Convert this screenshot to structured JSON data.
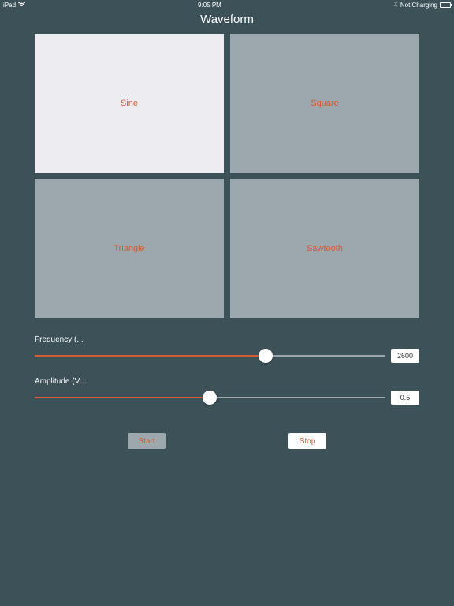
{
  "statusBar": {
    "device": "iPad",
    "time": "9:05 PM",
    "chargeStatus": "Not Charging"
  },
  "header": {
    "title": "Waveform"
  },
  "waveforms": [
    {
      "label": "Sine",
      "selected": true
    },
    {
      "label": "Square",
      "selected": false
    },
    {
      "label": "Triangle",
      "selected": false
    },
    {
      "label": "Sawtooth",
      "selected": false
    }
  ],
  "sliders": {
    "frequency": {
      "label": "Frequency (...",
      "value": "2600",
      "percent": 66
    },
    "amplitude": {
      "label": "Amplitude (Volu...",
      "value": "0.5",
      "percent": 50
    }
  },
  "buttons": {
    "start": "Start",
    "stop": "Stop"
  }
}
